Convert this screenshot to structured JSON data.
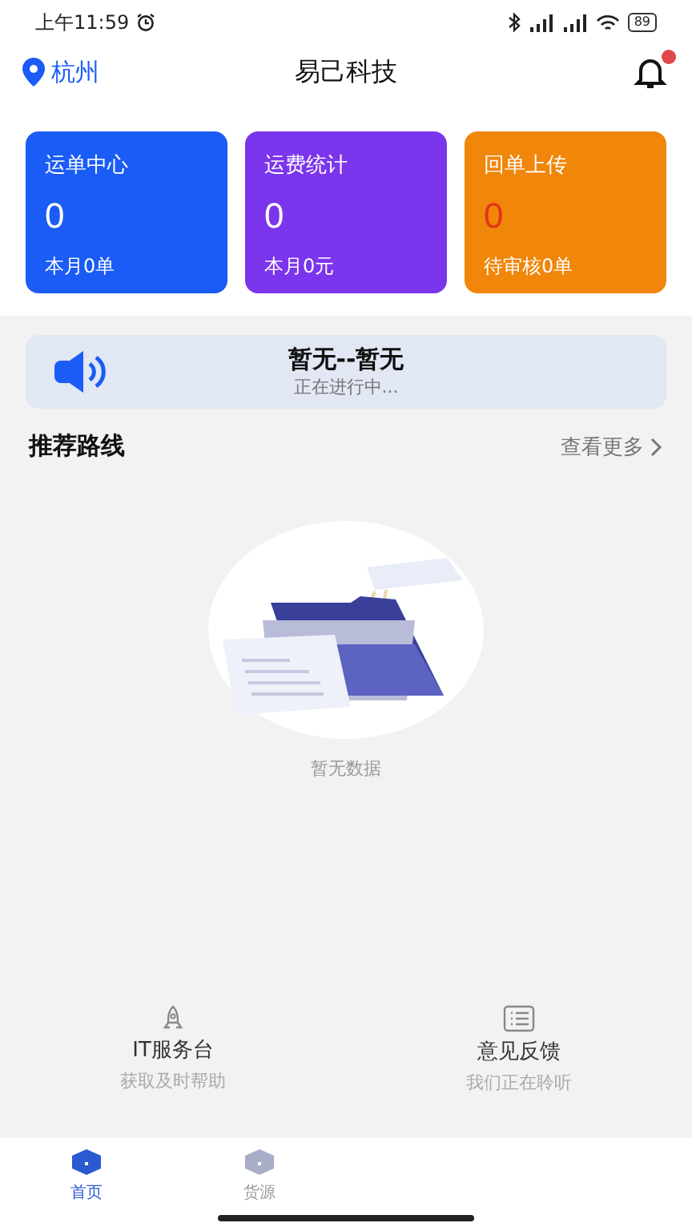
{
  "status_bar": {
    "time": "上午11:59",
    "battery": "89"
  },
  "header": {
    "city": "杭州",
    "title": "易己科技",
    "notification_dot": true
  },
  "cards": [
    {
      "title": "运单中心",
      "value": "0",
      "value_alert": false,
      "subtitle": "本月0单",
      "color": "#1a5cf5"
    },
    {
      "title": "运费统计",
      "value": "0",
      "value_alert": false,
      "subtitle": "本月0元",
      "color": "#7b35ec"
    },
    {
      "title": "回单上传",
      "value": "0",
      "value_alert": true,
      "subtitle": "待审核0单",
      "color": "#f0860a"
    }
  ],
  "notice": {
    "title": "暂无--暂无",
    "subtitle": "正在进行中..."
  },
  "section": {
    "title": "推荐路线",
    "more": "查看更多"
  },
  "empty_state": {
    "text": "暂无数据"
  },
  "services": [
    {
      "kind": "support",
      "title": "IT服务台",
      "subtitle": "获取及时帮助"
    },
    {
      "kind": "feedback",
      "title": "意见反馈",
      "subtitle": "我们正在聆听"
    }
  ],
  "tabs": [
    {
      "label": "首页",
      "selected": true
    },
    {
      "label": "货源",
      "selected": false
    }
  ]
}
